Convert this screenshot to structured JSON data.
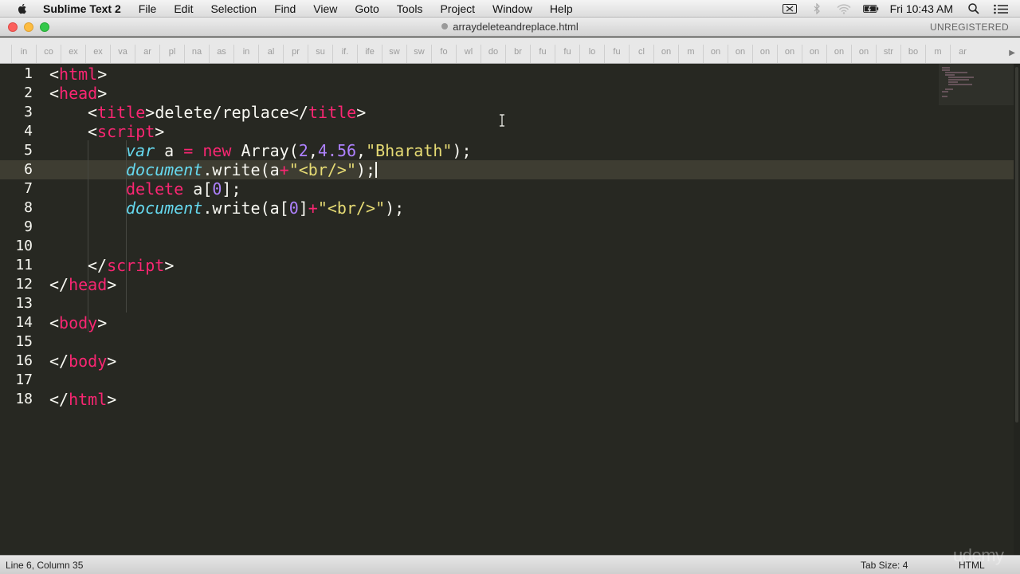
{
  "menubar": {
    "app_name": "Sublime Text 2",
    "items": [
      "File",
      "Edit",
      "Selection",
      "Find",
      "View",
      "Goto",
      "Tools",
      "Project",
      "Window",
      "Help"
    ],
    "clock": "Fri 10:43 AM",
    "status_icons": [
      "camera-icon",
      "bluetooth-icon",
      "wifi-icon",
      "battery-icon",
      "search-icon",
      "list-icon"
    ]
  },
  "window": {
    "title": "arraydeleteandreplace.html",
    "registration": "UNREGISTERED"
  },
  "tabs": [
    "in",
    "co",
    "ex",
    "ex",
    "va",
    "ar",
    "pl",
    "na",
    "as",
    "in",
    "al",
    "pr",
    "su",
    "if.",
    "ife",
    "sw",
    "sw",
    "fo",
    "wl",
    "do",
    "br",
    "fu",
    "fu",
    "lo",
    "fu",
    "cl",
    "on",
    "m",
    "on",
    "on",
    "on",
    "on",
    "on",
    "on",
    "on",
    "str",
    "bo",
    "m",
    "ar"
  ],
  "editor": {
    "current_line": 6,
    "lines": [
      {
        "n": "1"
      },
      {
        "n": "2"
      },
      {
        "n": "3"
      },
      {
        "n": "4"
      },
      {
        "n": "5"
      },
      {
        "n": "6"
      },
      {
        "n": "7"
      },
      {
        "n": "8"
      },
      {
        "n": "9"
      },
      {
        "n": "10"
      },
      {
        "n": "11"
      },
      {
        "n": "12"
      },
      {
        "n": "13"
      },
      {
        "n": "14"
      },
      {
        "n": "15"
      },
      {
        "n": "16"
      },
      {
        "n": "17"
      },
      {
        "n": "18"
      }
    ],
    "code": {
      "l1": [
        "<",
        "html",
        ">"
      ],
      "l2": [
        "<",
        "head",
        ">"
      ],
      "l3": [
        "<",
        "title",
        ">",
        "delete/replace",
        "</",
        "title",
        ">"
      ],
      "l4": [
        "<",
        "script",
        ">"
      ],
      "l5": [
        "var",
        " a ",
        "=",
        " ",
        "new",
        " Array(",
        "2",
        ",",
        "4.56",
        ",",
        "\"Bharath\"",
        ");"
      ],
      "l6": [
        "document",
        ".write(a",
        "+",
        "\"<br/>\"",
        ");"
      ],
      "l7": [
        "delete",
        " a[",
        "0",
        "];"
      ],
      "l8": [
        "document",
        ".write(a[",
        "0",
        "]",
        "+",
        "\"<br/>\"",
        ");"
      ],
      "l11": [
        "</",
        "script",
        ">"
      ],
      "l12": [
        "</",
        "head",
        ">"
      ],
      "l14": [
        "<",
        "body",
        ">"
      ],
      "l16": [
        "</",
        "body",
        ">"
      ],
      "l18": [
        "</",
        "html",
        ">"
      ]
    }
  },
  "statusbar": {
    "position": "Line 6, Column 35",
    "tab_size": "Tab Size: 4",
    "syntax": "HTML"
  },
  "watermark": "udemy",
  "colors": {
    "background": "#272822",
    "tag": "#f92672",
    "string": "#e6db74",
    "number": "#ae81ff",
    "keyword": "#66d9ef",
    "text": "#f8f8f2"
  }
}
